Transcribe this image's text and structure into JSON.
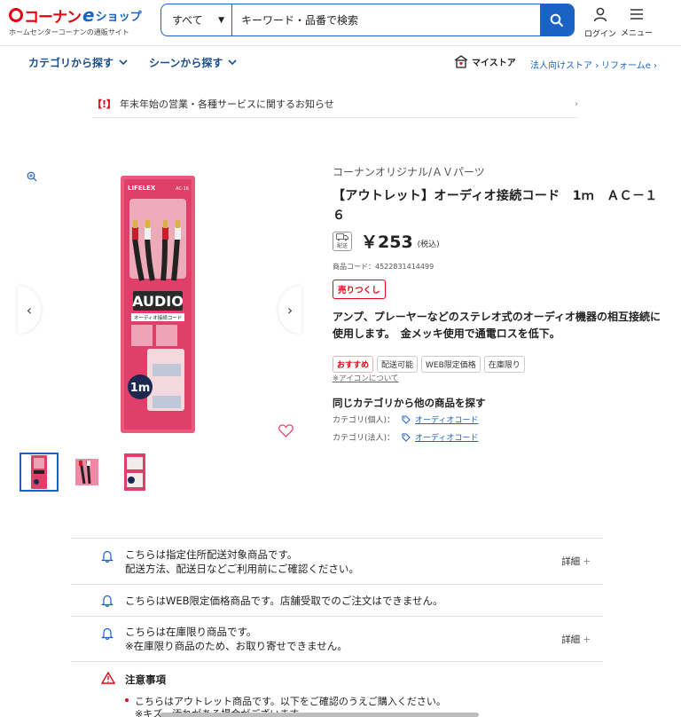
{
  "header": {
    "logo_text": "コーナン",
    "logo_e": "e",
    "logo_shop": "ショップ",
    "logo_sub": "ホームセンターコーナンの通販サイト",
    "search_category": "すべて",
    "search_placeholder": "キーワード・品番で検索",
    "login_label": "ログイン",
    "menu_label": "メニュー"
  },
  "nav": {
    "category": "カテゴリから探す",
    "scene": "シーンから探す",
    "mystore": "マイストア",
    "corporate": "法人向けストア",
    "reform": "リフォームe"
  },
  "notice": {
    "mark": "【!】",
    "text": "年末年始の営業・各種サービスに関するお知らせ"
  },
  "product": {
    "brand": "コーナンオリジナル/ＡＶパーツ",
    "title": "【アウトレット】オーディオ接続コード　1ｍ　ＡＣ－１６",
    "delivery_icon": "配送",
    "price": "￥253",
    "tax": "(税込)",
    "code": "商品コード：4522831414499",
    "soldout": "売りつくし",
    "description": "アンプ、プレーヤーなどのステレオ式のオーディオ機器の相互接続に使用します。　金メッキ使用で通電ロスを低下。",
    "badges": [
      "おすすめ",
      "配送可能",
      "WEB限定価格",
      "在庫限り"
    ],
    "icon_about": "※アイコンについて",
    "same_category": "同じカテゴリから他の商品を探す",
    "cat_personal_label": "カテゴリ(個人)：",
    "cat_personal_link": "オーディオコード",
    "cat_corporate_label": "カテゴリ(法人)：",
    "cat_corporate_link": "オーディオコード",
    "package_brand": "LIFELEX",
    "package_model": "AC-16",
    "package_title": "AUDIO",
    "package_sub": "オーディオ接続コード",
    "package_len": "1m"
  },
  "info_rows": [
    {
      "line1": "こちらは指定住所配送対象商品です。",
      "line2": "配送方法、配送日などご利用前にご確認ください。",
      "detail": "詳細"
    },
    {
      "line1": "こちらはWEB限定価格商品です。店舗受取でのご注文はできません。",
      "line2": "",
      "detail": ""
    },
    {
      "line1": "こちらは在庫限り商品です。",
      "line2": "※在庫限り商品のため、お取り寄せできません。",
      "detail": "詳細"
    }
  ],
  "caution": {
    "title": "注意事項",
    "line1": "こちらはアウトレット商品です。以下をご確認のうえご購入ください。",
    "line2": "※キズ・汚れがある場合がございます。"
  },
  "colors": {
    "brand_red": "#e60012",
    "brand_blue": "#1a62c3"
  }
}
